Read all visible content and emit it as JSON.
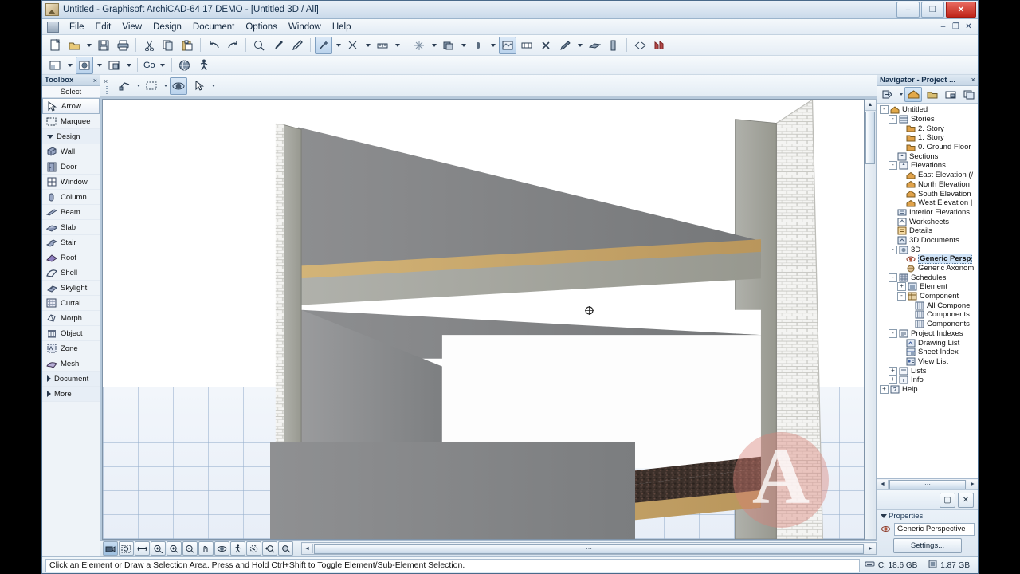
{
  "window": {
    "title": "Untitled - Graphisoft ArchiCAD-64 17 DEMO - [Untitled 3D / All]",
    "icon": "archicad-app-icon",
    "minimize": "–",
    "restore": "❐",
    "close": "✕",
    "mdi_minimize": "–",
    "mdi_restore": "❐",
    "mdi_close": "✕"
  },
  "menubar": {
    "items": [
      {
        "label": "File"
      },
      {
        "label": "Edit"
      },
      {
        "label": "View"
      },
      {
        "label": "Design"
      },
      {
        "label": "Document"
      },
      {
        "label": "Options"
      },
      {
        "label": "Window"
      },
      {
        "label": "Help"
      }
    ]
  },
  "toolbar_main": {
    "items": [
      {
        "name": "new-icon"
      },
      {
        "name": "open-icon",
        "dropdown": true
      },
      {
        "name": "save-icon"
      },
      {
        "name": "print-icon"
      },
      {
        "sep": true
      },
      {
        "name": "cut-icon"
      },
      {
        "name": "copy-icon"
      },
      {
        "name": "paste-icon"
      },
      {
        "sep": true
      },
      {
        "name": "undo-icon"
      },
      {
        "name": "redo-icon"
      },
      {
        "sep": true
      },
      {
        "name": "search-zoom-icon"
      },
      {
        "name": "eyedropper-icon"
      },
      {
        "name": "syringe-icon"
      },
      {
        "sep": true
      },
      {
        "name": "magic-wand-icon",
        "active": true,
        "dropdown": true
      },
      {
        "name": "scissors-icon",
        "dropdown": true
      },
      {
        "name": "measure-icon",
        "dropdown": true
      },
      {
        "sep": true
      },
      {
        "name": "grid-snap-icon",
        "dropdown": true
      },
      {
        "name": "layers-icon",
        "dropdown": true
      },
      {
        "name": "pen-weight-icon",
        "dropdown": true
      },
      {
        "name": "render-icon",
        "active": true
      },
      {
        "name": "dimension-icon"
      },
      {
        "name": "close-x-icon"
      },
      {
        "name": "trace-icon",
        "dropdown": true
      },
      {
        "name": "slab-tool-icon"
      },
      {
        "name": "wall-tool-icon"
      },
      {
        "sep": true
      },
      {
        "name": "marquee-tool-icon"
      },
      {
        "name": "teamwork-icon"
      }
    ]
  },
  "toolbar_second": {
    "go_label": "Go",
    "items": [
      {
        "name": "view-window-icon",
        "dropdown": true
      },
      {
        "name": "3d-window-icon",
        "active": true,
        "dropdown": true
      },
      {
        "name": "layout-window-icon",
        "dropdown": true
      },
      {
        "name": "go-navigate",
        "dropdown": true
      },
      {
        "name": "globe-icon"
      },
      {
        "name": "walk-icon"
      }
    ]
  },
  "toolbox": {
    "title": "Toolbox",
    "close": "×",
    "section_select": "Select",
    "items": [
      {
        "label": "Arrow",
        "icon": "arrow-icon",
        "selected": true
      },
      {
        "label": "Marquee",
        "icon": "marquee-icon"
      },
      {
        "label": "Design",
        "icon": "triangle-down",
        "group": true
      },
      {
        "label": "Wall",
        "icon": "wall-icon"
      },
      {
        "label": "Door",
        "icon": "door-icon"
      },
      {
        "label": "Window",
        "icon": "window-icon"
      },
      {
        "label": "Column",
        "icon": "column-icon"
      },
      {
        "label": "Beam",
        "icon": "beam-icon"
      },
      {
        "label": "Slab",
        "icon": "slab-icon"
      },
      {
        "label": "Stair",
        "icon": "stair-icon"
      },
      {
        "label": "Roof",
        "icon": "roof-icon"
      },
      {
        "label": "Shell",
        "icon": "shell-icon"
      },
      {
        "label": "Skylight",
        "icon": "skylight-icon"
      },
      {
        "label": "Curtai...",
        "icon": "curtain-wall-icon"
      },
      {
        "label": "Morph",
        "icon": "morph-icon"
      },
      {
        "label": "Object",
        "icon": "object-icon"
      },
      {
        "label": "Zone",
        "icon": "zone-icon"
      },
      {
        "label": "Mesh",
        "icon": "mesh-icon"
      },
      {
        "label": "Document",
        "icon": "triangle-right",
        "group": true
      },
      {
        "label": "More",
        "icon": "triangle-right",
        "group": true
      }
    ]
  },
  "infobox": {
    "items": [
      {
        "name": "3d-view-settings-icon",
        "dropdown": true
      },
      {
        "name": "marquee-select-icon",
        "dropdown": true
      },
      {
        "name": "orbit-icon",
        "active": true
      },
      {
        "name": "arrow-pointer-icon",
        "dropdown": true
      }
    ]
  },
  "viewport": {
    "cursor": "orbit-cursor",
    "scroll": {
      "up": "▲",
      "down": "▼",
      "left": "◄",
      "right": "►",
      "thumb": "⋯"
    }
  },
  "view_toolbar": {
    "items": [
      {
        "name": "3d-camera-icon",
        "active": true
      },
      {
        "name": "zoom-window-icon"
      },
      {
        "name": "fit-in-window-icon"
      },
      {
        "name": "zoom-actual-icon"
      },
      {
        "name": "zoom-in-icon"
      },
      {
        "name": "zoom-out-icon"
      },
      {
        "name": "pan-icon"
      },
      {
        "name": "orbit-view-icon"
      },
      {
        "name": "explore-walk-icon"
      },
      {
        "name": "previous-zoom-icon"
      },
      {
        "name": "next-zoom-icon"
      },
      {
        "name": "navigator-preview-icon"
      }
    ],
    "more": "◄"
  },
  "navigator": {
    "title": "Navigator - Project ...",
    "close": "×",
    "tools": [
      {
        "name": "navigator-back-icon",
        "dropdown": true
      },
      {
        "name": "project-map-icon",
        "active": true
      },
      {
        "name": "view-map-icon"
      },
      {
        "name": "layout-book-icon"
      },
      {
        "name": "publisher-sets-icon"
      }
    ],
    "tree": [
      {
        "label": "Untitled",
        "depth": 0,
        "exp": "-",
        "icon": "project-home-icon"
      },
      {
        "label": "Stories",
        "depth": 1,
        "exp": "-",
        "icon": "stories-icon"
      },
      {
        "label": "2. Story",
        "depth": 2,
        "exp": "",
        "icon": "story-folder-icon"
      },
      {
        "label": "1. Story",
        "depth": 2,
        "exp": "",
        "icon": "story-folder-icon"
      },
      {
        "label": "0. Ground Floor",
        "depth": 2,
        "exp": "",
        "icon": "story-folder-icon"
      },
      {
        "label": "Sections",
        "depth": 1,
        "exp": "",
        "icon": "sections-icon"
      },
      {
        "label": "Elevations",
        "depth": 1,
        "exp": "-",
        "icon": "elevations-icon"
      },
      {
        "label": "East Elevation (/",
        "depth": 2,
        "exp": "",
        "icon": "elevation-item-icon"
      },
      {
        "label": "North Elevation",
        "depth": 2,
        "exp": "",
        "icon": "elevation-item-icon"
      },
      {
        "label": "South Elevation",
        "depth": 2,
        "exp": "",
        "icon": "elevation-item-icon"
      },
      {
        "label": "West Elevation |",
        "depth": 2,
        "exp": "",
        "icon": "elevation-item-icon"
      },
      {
        "label": "Interior Elevations",
        "depth": 1,
        "exp": "",
        "icon": "interior-elevations-icon"
      },
      {
        "label": "Worksheets",
        "depth": 1,
        "exp": "",
        "icon": "worksheets-icon"
      },
      {
        "label": "Details",
        "depth": 1,
        "exp": "",
        "icon": "details-icon"
      },
      {
        "label": "3D Documents",
        "depth": 1,
        "exp": "",
        "icon": "3d-documents-icon"
      },
      {
        "label": "3D",
        "depth": 1,
        "exp": "-",
        "icon": "3d-icon"
      },
      {
        "label": "Generic Persp",
        "depth": 2,
        "exp": "",
        "icon": "perspective-icon",
        "selected": true
      },
      {
        "label": "Generic Axonom",
        "depth": 2,
        "exp": "",
        "icon": "axonometry-icon"
      },
      {
        "label": "Schedules",
        "depth": 1,
        "exp": "-",
        "icon": "schedules-icon"
      },
      {
        "label": "Element",
        "depth": 2,
        "exp": "+",
        "icon": "schedule-element-icon"
      },
      {
        "label": "Component",
        "depth": 2,
        "exp": "-",
        "icon": "schedule-component-icon"
      },
      {
        "label": "All Compone",
        "depth": 3,
        "exp": "",
        "icon": "schedule-table-icon"
      },
      {
        "label": "Components",
        "depth": 3,
        "exp": "",
        "icon": "schedule-table-icon"
      },
      {
        "label": "Components",
        "depth": 3,
        "exp": "",
        "icon": "schedule-table-icon"
      },
      {
        "label": "Project Indexes",
        "depth": 1,
        "exp": "-",
        "icon": "project-indexes-icon"
      },
      {
        "label": "Drawing List",
        "depth": 2,
        "exp": "",
        "icon": "drawing-list-icon"
      },
      {
        "label": "Sheet Index",
        "depth": 2,
        "exp": "",
        "icon": "sheet-index-icon"
      },
      {
        "label": "View List",
        "depth": 2,
        "exp": "",
        "icon": "view-list-icon"
      },
      {
        "label": "Lists",
        "depth": 1,
        "exp": "+",
        "icon": "lists-icon"
      },
      {
        "label": "Info",
        "depth": 1,
        "exp": "+",
        "icon": "info-icon"
      },
      {
        "label": "Help",
        "depth": 0,
        "exp": "+",
        "icon": "help-icon"
      }
    ],
    "hscroll": {
      "left": "◄",
      "right": "►",
      "thumb": "⋯"
    },
    "buttons": [
      {
        "name": "new-folder-button",
        "glyph": "▢"
      },
      {
        "name": "delete-button",
        "glyph": "✕"
      }
    ],
    "properties": {
      "title": "Properties",
      "icon": "perspective-small-icon",
      "value": "Generic Perspective",
      "settings_button": "Settings..."
    }
  },
  "statusbar": {
    "message": "Click an Element or Draw a Selection Area. Press and Hold Ctrl+Shift to Toggle Element/Sub-Element Selection.",
    "drive_label": "C: 18.6 GB",
    "memory_label": "1.87 GB",
    "drive_icon": "hard-drive-icon",
    "memory_icon": "memory-icon"
  },
  "watermark": {
    "letter": "A"
  },
  "colors": {
    "accent": "#2a4560",
    "close_red": "#bf2419",
    "wall_gray": "#8f9092",
    "wall_gray_dark": "#6f7173",
    "concrete": "#a8a9a2",
    "insulation": "#c9a96a",
    "floor_granite": "#3b2f2a",
    "ground_grid": "#96afcd",
    "selection_blue": "#cfe3f7",
    "watermark_pink": "#d88078"
  }
}
